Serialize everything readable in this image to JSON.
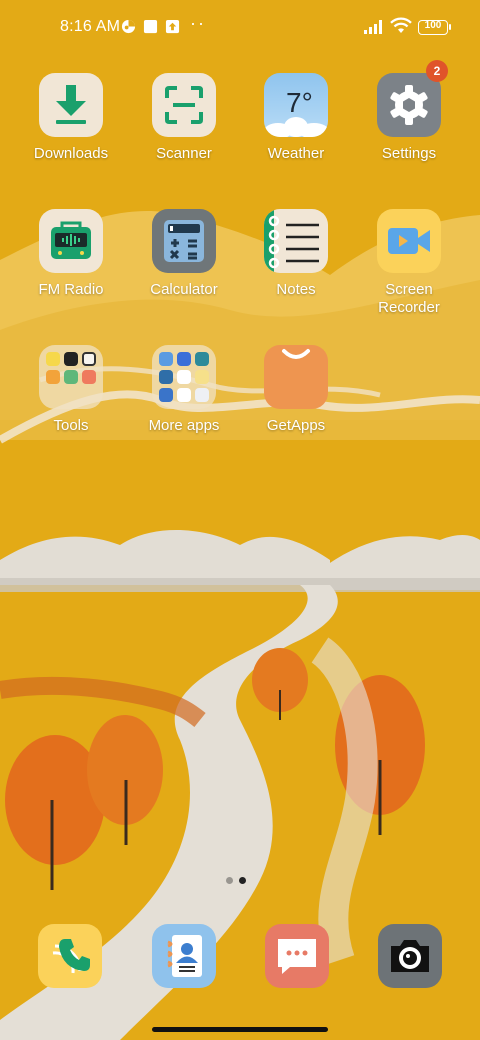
{
  "status_bar": {
    "time": "8:16 AM",
    "notification_icons": [
      "vpn-icon",
      "square-notification-icon",
      "upload-notification-icon"
    ],
    "overflow": "··",
    "battery": "100",
    "system_icons": [
      "signal-icon",
      "wifi-icon",
      "battery-icon"
    ]
  },
  "apps": [
    {
      "name": "downloads",
      "label": "Downloads",
      "icon": "download-icon"
    },
    {
      "name": "scanner",
      "label": "Scanner",
      "icon": "scanner-icon"
    },
    {
      "name": "weather",
      "label": "Weather",
      "icon": "weather-icon",
      "temp": "7°"
    },
    {
      "name": "settings",
      "label": "Settings",
      "icon": "gear-icon",
      "badge": "2"
    },
    {
      "name": "fm-radio",
      "label": "FM Radio",
      "icon": "radio-icon"
    },
    {
      "name": "calculator",
      "label": "Calculator",
      "icon": "calculator-icon"
    },
    {
      "name": "notes",
      "label": "Notes",
      "icon": "notes-icon"
    },
    {
      "name": "screen-recorder",
      "label": "Screen Recorder",
      "icon": "video-camera-icon"
    },
    {
      "name": "tools-folder",
      "label": "Tools",
      "icon": "folder-icon"
    },
    {
      "name": "more-apps-folder",
      "label": "More apps",
      "icon": "folder-icon"
    },
    {
      "name": "getapps",
      "label": "GetApps",
      "icon": "shopping-bag-icon"
    }
  ],
  "dock": [
    {
      "name": "phone",
      "icon": "phone-icon"
    },
    {
      "name": "contacts",
      "icon": "contacts-icon"
    },
    {
      "name": "messages",
      "icon": "message-icon"
    },
    {
      "name": "camera",
      "icon": "camera-icon"
    }
  ],
  "page_indicator": {
    "pages": 2,
    "current": 2
  },
  "colors": {
    "wallpaper": "#e3aa16",
    "badge": "#e0542a",
    "download_green": "#1aa06c",
    "settings_gray": "#7c8288",
    "recorder_yellow": "#fbd25a",
    "getapps_orange": "#ee9550",
    "messages_salmon": "#e77a66"
  }
}
